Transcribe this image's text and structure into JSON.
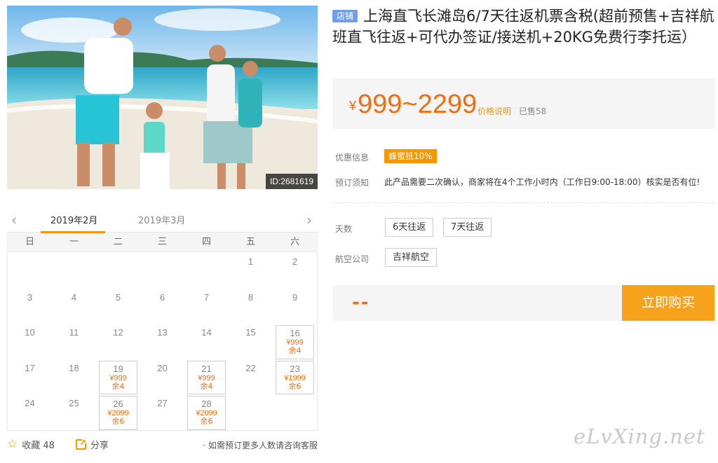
{
  "photo": {
    "id_label": "ID:2681619"
  },
  "product": {
    "badge": "店铺",
    "title": "上海直飞长滩岛6/7天往返机票含税(超前预售+吉祥航班直飞往返+可代办签证/接送机+20KG免费行李托运）"
  },
  "price": {
    "currency": "¥",
    "range": "999~2299",
    "note": "价格说明",
    "sold": "已售58"
  },
  "promo": {
    "label": "优惠信息",
    "tag": "蜂蜜抵10%"
  },
  "notice": {
    "label": "预订须知",
    "text": "此产品需要二次确认，商家将在4个工作小时内（工作日9:00-18:00）核实是否有位!"
  },
  "options": {
    "days": {
      "label": "天数",
      "items": [
        "6天往返",
        "7天往返"
      ]
    },
    "airline": {
      "label": "航空公司",
      "items": [
        "吉祥航空"
      ]
    }
  },
  "buy": {
    "total": "--",
    "button": "立即购买"
  },
  "calendar": {
    "months": [
      "2019年2月",
      "2019年3月"
    ],
    "weekdays": [
      "日",
      "一",
      "二",
      "三",
      "四",
      "五",
      "六"
    ],
    "days": [
      {
        "d": "1"
      },
      {
        "d": "2"
      },
      {
        "d": "3"
      },
      {
        "d": "4"
      },
      {
        "d": "5"
      },
      {
        "d": "6"
      },
      {
        "d": "7"
      },
      {
        "d": "8"
      },
      {
        "d": "9"
      },
      {
        "d": "10"
      },
      {
        "d": "11"
      },
      {
        "d": "12"
      },
      {
        "d": "13"
      },
      {
        "d": "14"
      },
      {
        "d": "15"
      },
      {
        "d": "16",
        "price": "¥999",
        "stock": "余4"
      },
      {
        "d": "17"
      },
      {
        "d": "18"
      },
      {
        "d": "19",
        "price": "¥999",
        "stock": "余4"
      },
      {
        "d": "20"
      },
      {
        "d": "21",
        "price": "¥999",
        "stock": "余4"
      },
      {
        "d": "22"
      },
      {
        "d": "23",
        "price": "¥1999",
        "stock": "余6"
      },
      {
        "d": "24"
      },
      {
        "d": "25"
      },
      {
        "d": "26",
        "price": "¥2099",
        "stock": "余6"
      },
      {
        "d": "27"
      },
      {
        "d": "28",
        "price": "¥2099",
        "stock": "余6"
      }
    ],
    "first_weekday": 5
  },
  "footer": {
    "favorite": "收藏 48",
    "share": "分享",
    "consult": "· 如需预订更多人数请咨询客服"
  },
  "watermark": "eLvXing.net",
  "colors": {
    "accent": "#f39800",
    "price": "#f56c0e",
    "badge": "#6d9ee8"
  }
}
